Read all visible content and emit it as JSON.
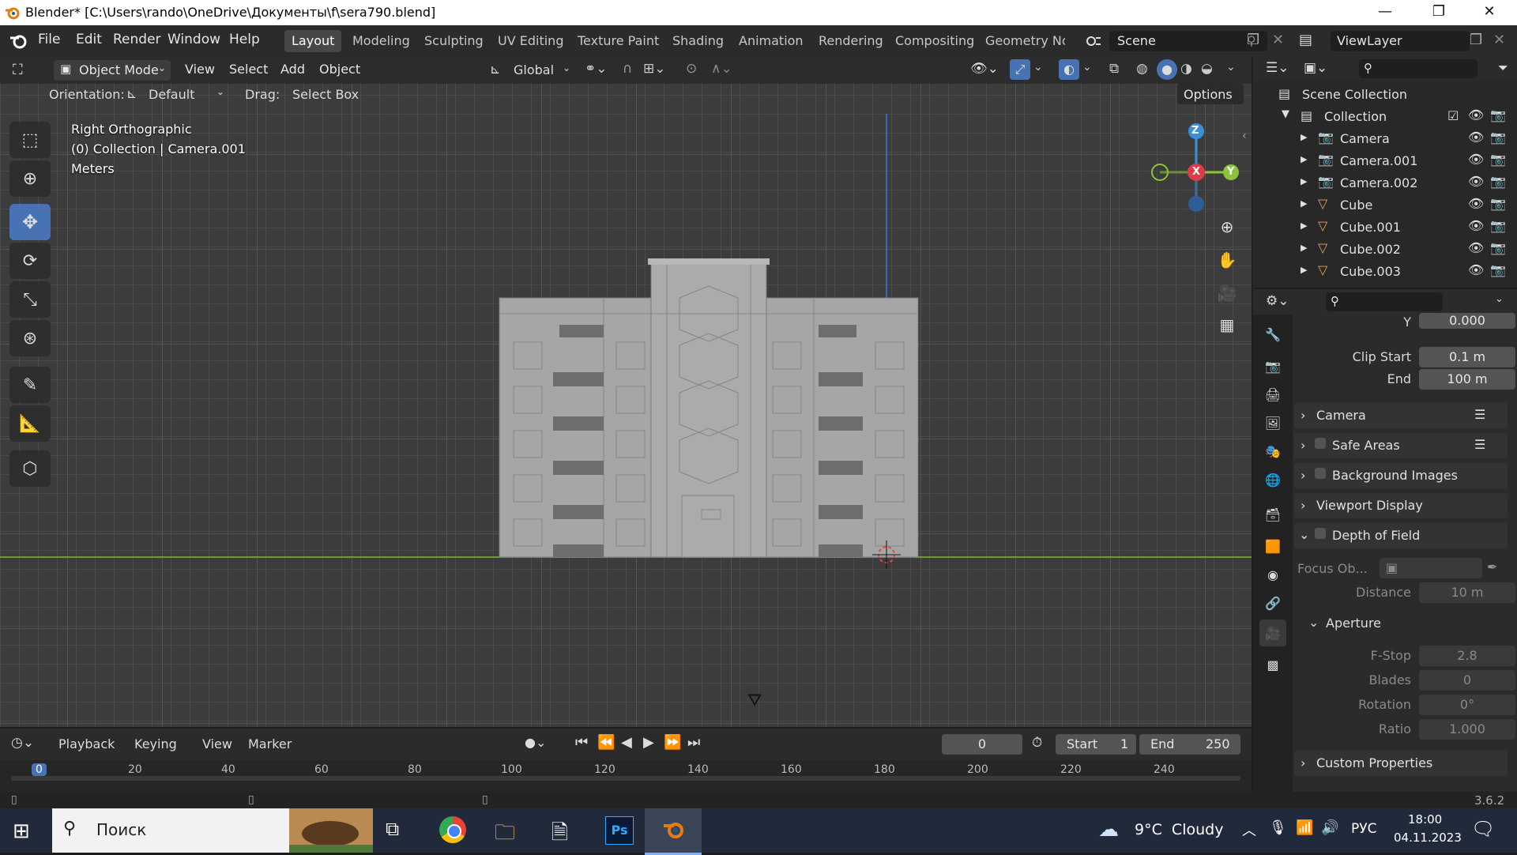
{
  "window": {
    "title": "Blender* [C:\\Users\\rando\\OneDrive\\Документы\\f\\sera790.blend]",
    "minimize": "—",
    "maximize": "❐",
    "close": "✕"
  },
  "menu": [
    "File",
    "Edit",
    "Render",
    "Window",
    "Help"
  ],
  "workspaces": [
    "Layout",
    "Modeling",
    "Sculpting",
    "UV Editing",
    "Texture Paint",
    "Shading",
    "Animation",
    "Rendering",
    "Compositing",
    "Geometry Noc"
  ],
  "active_workspace": "Layout",
  "scene": "Scene",
  "view_layer": "ViewLayer",
  "viewport_header": {
    "mode": "Object Mode",
    "menus": [
      "View",
      "Select",
      "Add",
      "Object"
    ],
    "transform": "Global",
    "orientation_label": "Orientation:",
    "orientation": "Default",
    "drag_label": "Drag:",
    "drag": "Select Box",
    "options": "Options"
  },
  "viewport_info": {
    "view": "Right Orthographic",
    "collection": "(0) Collection | Camera.001",
    "units": "Meters"
  },
  "gizmo": {
    "z": "Z",
    "x": "X",
    "y": "Y"
  },
  "outliner": {
    "root": "Scene Collection",
    "collection": "Collection",
    "items": [
      {
        "name": "Camera",
        "type": "camera"
      },
      {
        "name": "Camera.001",
        "type": "camera"
      },
      {
        "name": "Camera.002",
        "type": "camera"
      },
      {
        "name": "Cube",
        "type": "mesh"
      },
      {
        "name": "Cube.001",
        "type": "mesh"
      },
      {
        "name": "Cube.002",
        "type": "mesh"
      },
      {
        "name": "Cube.003",
        "type": "mesh"
      }
    ]
  },
  "properties": {
    "y_label": "Y",
    "y_value": "0.000",
    "clip_start_label": "Clip Start",
    "clip_start": "0.1 m",
    "clip_end_label": "End",
    "clip_end": "100 m",
    "panels": [
      "Camera",
      "Safe Areas",
      "Background Images",
      "Viewport Display"
    ],
    "dof": "Depth of Field",
    "focus_obj_label": "Focus Ob...",
    "distance_label": "Distance",
    "distance": "10 m",
    "aperture": "Aperture",
    "fstop_label": "F-Stop",
    "fstop": "2.8",
    "blades_label": "Blades",
    "blades": "0",
    "rotation_label": "Rotation",
    "rotation": "0°",
    "ratio_label": "Ratio",
    "ratio": "1.000",
    "custom": "Custom Properties"
  },
  "timeline": {
    "menus": [
      "Playback",
      "Keying",
      "View",
      "Marker"
    ],
    "current_frame": "0",
    "start_label": "Start",
    "start": "1",
    "end_label": "End",
    "end": "250",
    "ticks": [
      "0",
      "20",
      "40",
      "60",
      "80",
      "100",
      "120",
      "140",
      "160",
      "180",
      "200",
      "220",
      "240"
    ]
  },
  "status": {
    "version": "3.6.2"
  },
  "taskbar": {
    "search": "Поиск",
    "weather": "9°C  Cloudy",
    "lang": "РУС",
    "time": "18:00",
    "date": "04.11.2023"
  },
  "colors": {
    "accent": "#4772b3",
    "axis_x": "#e0394a",
    "axis_y": "#8bc43a",
    "axis_z": "#3b8ed8",
    "building": "#a8a8a8",
    "outliner_icon": "#e8a34a"
  }
}
